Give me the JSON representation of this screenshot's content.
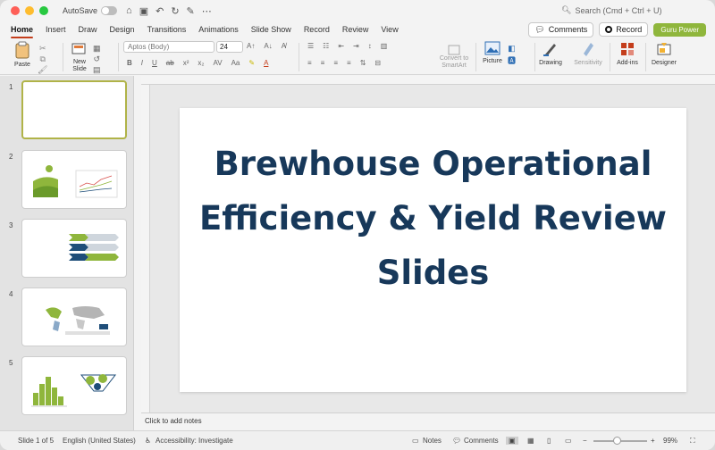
{
  "titlebar": {
    "autosave_label": "AutoSave",
    "search_placeholder": "Search (Cmd + Ctrl + U)"
  },
  "tabs": [
    "Home",
    "Insert",
    "Draw",
    "Design",
    "Transitions",
    "Animations",
    "Slide Show",
    "Record",
    "Review",
    "View"
  ],
  "tab_actions": {
    "comments": "Comments",
    "record": "Record",
    "guru": "Guru Power"
  },
  "ribbon": {
    "paste": "Paste",
    "new_slide": "New\nSlide",
    "font_name": "Aptos (Body)",
    "font_size": "24",
    "convert_smartart": "Convert to\nSmartArt",
    "picture": "Picture",
    "drawing": "Drawing",
    "sensitivity": "Sensitivity",
    "addins": "Add-ins",
    "designer": "Designer"
  },
  "slides": {
    "numbers": [
      "1",
      "2",
      "3",
      "4",
      "5"
    ]
  },
  "main_slide": {
    "title": "Brewhouse Operational Efficiency & Yield Review Slides"
  },
  "notes_placeholder": "Click to add notes",
  "status": {
    "slide_info": "Slide 1 of 5",
    "language": "English (United States)",
    "accessibility": "Accessibility: Investigate",
    "notes": "Notes",
    "comments": "Comments",
    "zoom": "99%"
  },
  "colors": {
    "accent_tab": "#c43e1c",
    "title_color": "#17385a",
    "green": "#8fb63c",
    "navy": "#1f4e79"
  }
}
